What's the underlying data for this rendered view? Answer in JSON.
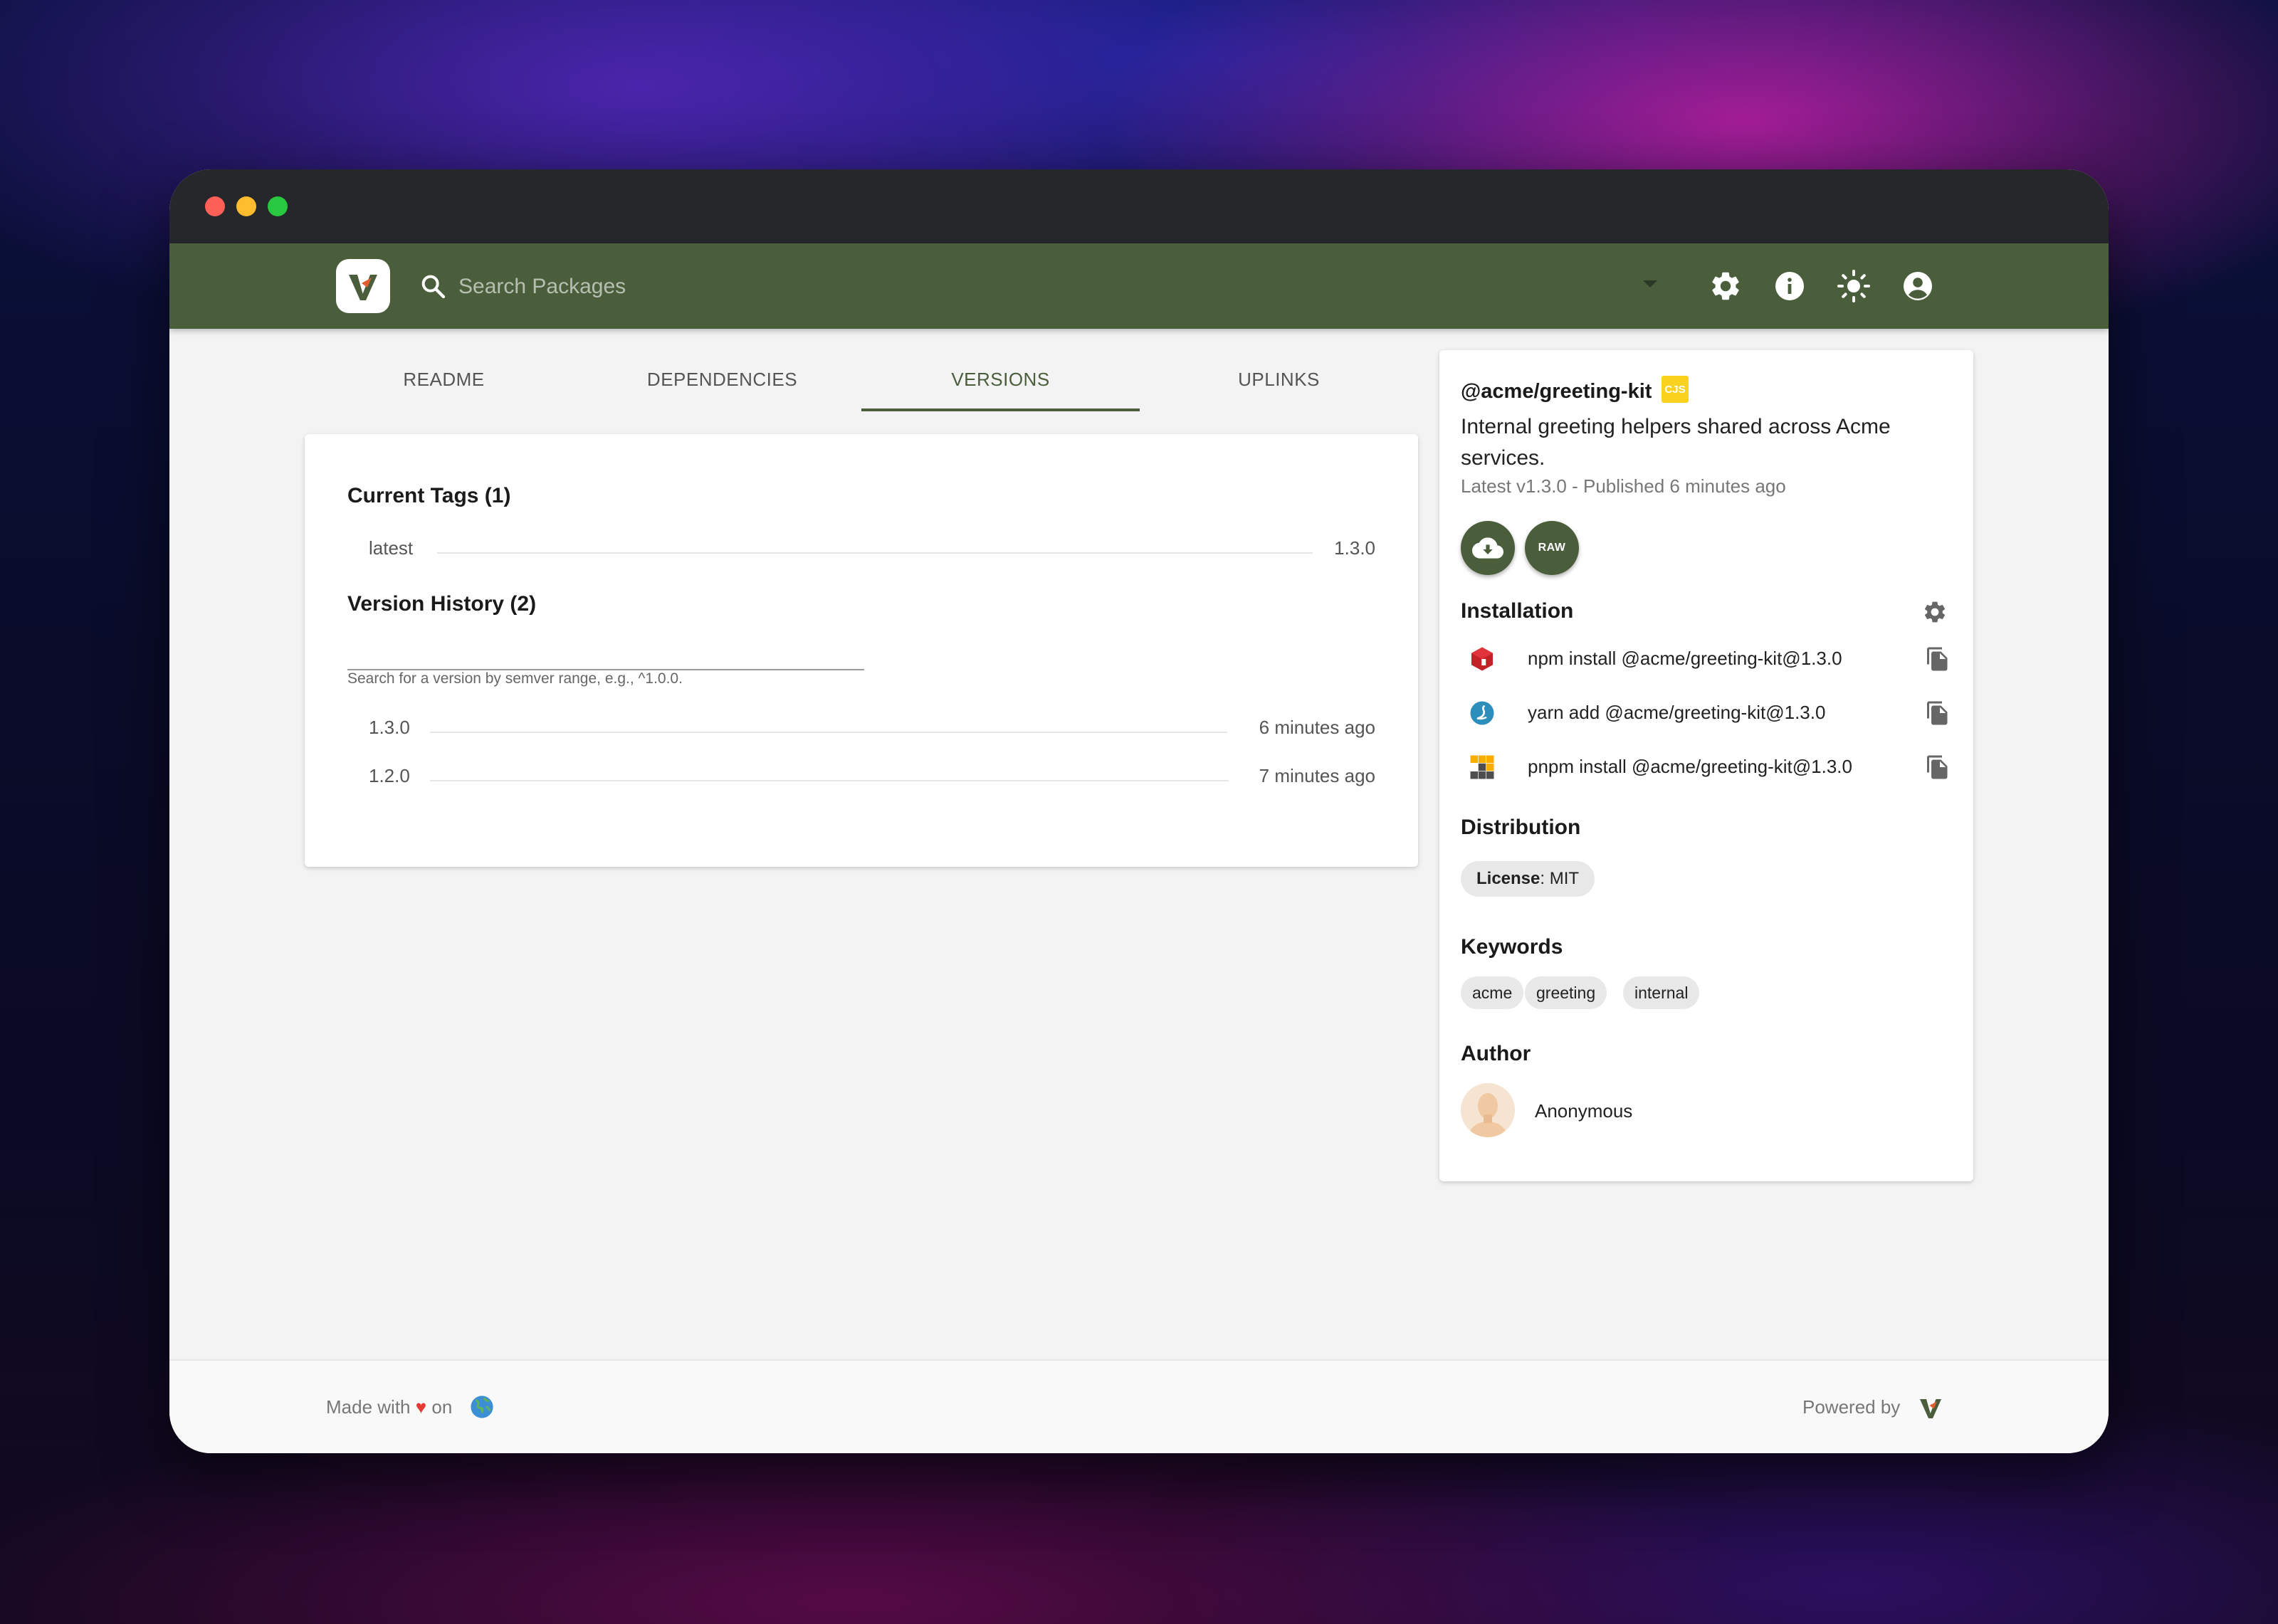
{
  "header": {
    "search_placeholder": "Search Packages"
  },
  "tabs": [
    {
      "label": "README"
    },
    {
      "label": "DEPENDENCIES"
    },
    {
      "label": "VERSIONS",
      "active": true
    },
    {
      "label": "UPLINKS"
    }
  ],
  "versions": {
    "current_tags_title": "Current Tags (1)",
    "tags": [
      {
        "name": "latest",
        "version": "1.3.0"
      }
    ],
    "history_title": "Version History (2)",
    "search_helper": "Search for a version by semver range, e.g., ^1.0.0.",
    "history": [
      {
        "version": "1.3.0",
        "time": "6 minutes ago"
      },
      {
        "version": "1.2.0",
        "time": "7 minutes ago"
      }
    ]
  },
  "package": {
    "name": "@acme/greeting-kit",
    "module_badge": "CJS",
    "description": "Internal greeting helpers shared across Acme services.",
    "meta": "Latest v1.3.0 - Published 6 minutes ago",
    "raw_label": "RAW"
  },
  "installation": {
    "title": "Installation",
    "commands": [
      {
        "tool": "npm",
        "icon": "npm-icon",
        "command": "npm install @acme/greeting-kit@1.3.0"
      },
      {
        "tool": "yarn",
        "icon": "yarn-icon",
        "command": "yarn add @acme/greeting-kit@1.3.0"
      },
      {
        "tool": "pnpm",
        "icon": "pnpm-icon",
        "command": "pnpm install @acme/greeting-kit@1.3.0"
      }
    ]
  },
  "distribution": {
    "title": "Distribution",
    "license_label": "License",
    "license_value": ": MIT"
  },
  "keywords": {
    "title": "Keywords",
    "items": [
      "acme",
      "greeting",
      "internal"
    ]
  },
  "author": {
    "title": "Author",
    "name": "Anonymous"
  },
  "footer": {
    "made_with": "Made with",
    "on": "on",
    "powered_by": "Powered by"
  },
  "colors": {
    "primary": "#4a5e3c",
    "heart": "#e53935",
    "cjs_badge": "#f8d21c"
  }
}
